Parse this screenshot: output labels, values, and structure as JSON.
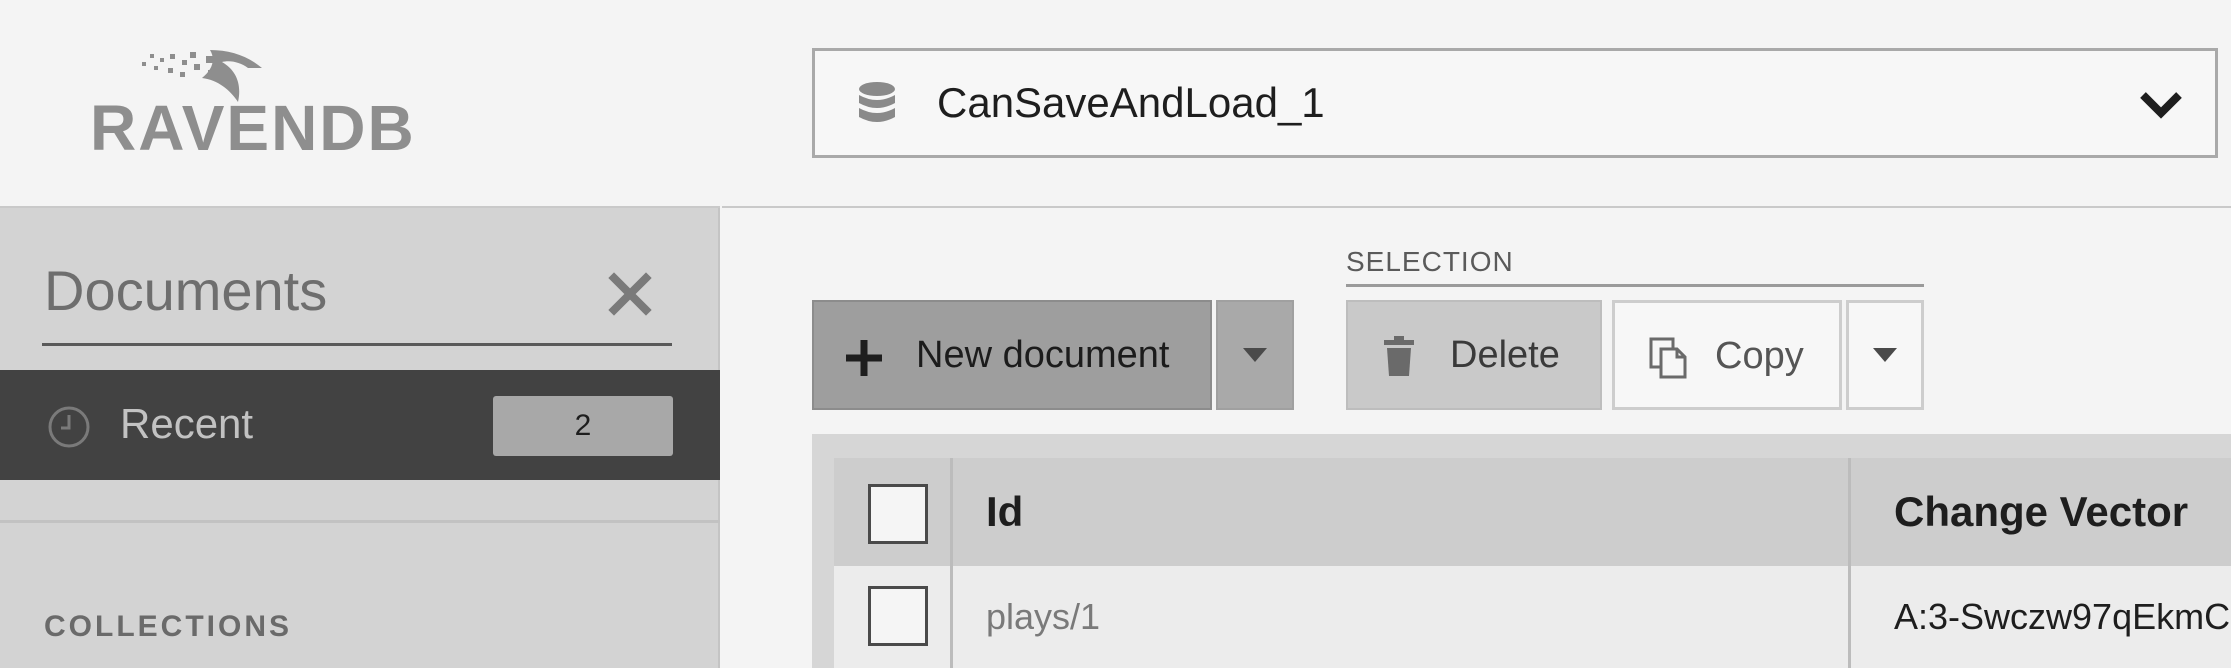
{
  "sidebar": {
    "logo_text": "RAVENDB",
    "section_title": "Documents",
    "recent": {
      "label": "Recent",
      "count": "2"
    },
    "collections_label": "COLLECTIONS"
  },
  "topbar": {
    "database_name": "CanSaveAndLoad_1"
  },
  "toolbar": {
    "new_document_label": "New document",
    "selection_label": "SELECTION",
    "delete_label": "Delete",
    "copy_label": "Copy"
  },
  "table": {
    "columns": [
      "Id",
      "Change Vector"
    ],
    "rows": [
      {
        "id": "plays/1",
        "change_vector": "A:3-Swczw97qEkmC"
      }
    ]
  },
  "icons": [
    "database-icon",
    "chevron-down-icon",
    "close-icon",
    "clock-icon",
    "plus-icon",
    "trash-icon",
    "copy-icon",
    "caret-down-icon"
  ],
  "colors": {
    "active_row_bg": "#424242",
    "badge_bg": "#a8a8a8"
  }
}
